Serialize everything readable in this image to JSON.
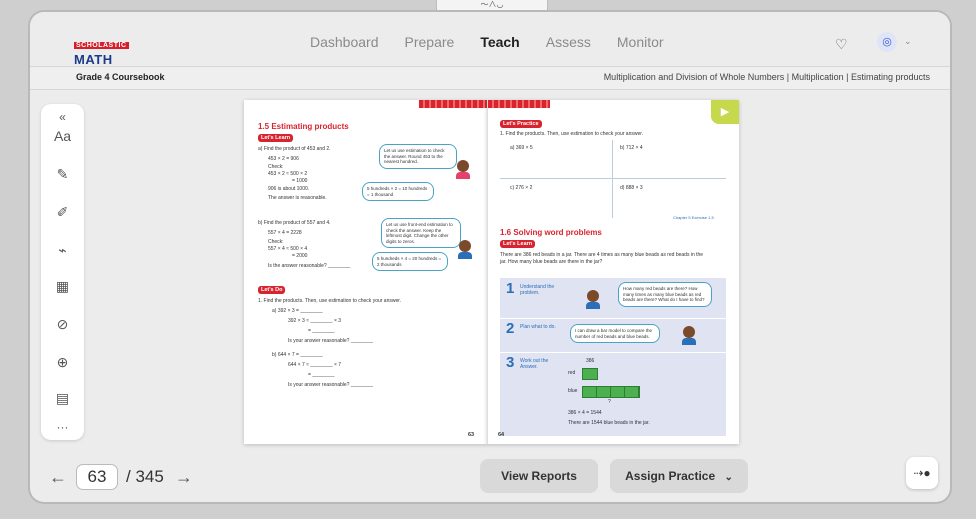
{
  "logo": {
    "top": "SCHOLASTIC",
    "main": "MATH PRO"
  },
  "nav": {
    "tabs": [
      "Dashboard",
      "Prepare",
      "Teach",
      "Assess",
      "Monitor"
    ],
    "active": "Teach"
  },
  "coursebook": "Grade 4 Coursebook",
  "breadcrumb": "Multiplication and Division of Whole Numbers | Multiplication | Estimating products",
  "toolbar": {
    "collapse": "«",
    "text_tool": "Aa",
    "more": "···"
  },
  "left_page": {
    "title": "1.5 Estimating products",
    "lets_learn": "Let's Learn",
    "a_q": "a)  Find the product of 453 and 2.",
    "a_eq": "453 × 2 = 906",
    "a_check": "Check:",
    "a_c1": "453 × 2 ≈ 500 × 2",
    "a_c2": "= 1000",
    "a_c3": "906 is about 1000.",
    "a_c4": "The answer is reasonable.",
    "a_bubble": "Let us use estimation to check the answer. Round 453 to the nearest hundred.",
    "a_note": "5 hundreds × 2 = 10 hundreds = 1 thousand",
    "b_q": "b)  Find the product of 557 and 4.",
    "b_eq": "557 × 4 = 2228",
    "b_check": "Check:",
    "b_c1": "557 × 4 ≈ 500 × 4",
    "b_c2": "= 2000",
    "b_c3": "Is the answer reasonable? ________",
    "b_bubble": "Let us use front-end estimation to check the answer. Keep the leftmost digit. Change the other digits to zeros.",
    "b_note": "5 hundreds × 4 = 20 hundreds = 2 thousands",
    "lets_do": "Let's Do",
    "d1": "1.  Find the products. Then, use estimation to check your answer.",
    "d_a1": "a)  392 × 3 = ________",
    "d_a2": "392 × 3 ≈ ________ × 3",
    "d_a3": "= ________",
    "d_a4": "Is your answer reasonable? ________",
    "d_b1": "b)  644 × 7 = ________",
    "d_b2": "644 × 7 ≈ ________ × 7",
    "d_b3": "= ________",
    "d_b4": "Is your answer reasonable? ________",
    "page_number": "63"
  },
  "right_page": {
    "lets_practice": "Let's Practice",
    "p1": "1.  Find the products. Then, use estimation to check your answer.",
    "pa": "a)  369 × 5",
    "pb": "b)  712 × 4",
    "pc": "c)  276 × 2",
    "pd": "d)  888 × 3",
    "exercise": "Chapter 5 Exercise 1.5",
    "title": "1.6 Solving word problems",
    "lets_learn": "Let's Learn",
    "problem": "There are 386 red beads in a jar. There are 4 times as many blue beads as red beads in the jar. How many blue beads are there in the jar?",
    "s1": "Understand the problem.",
    "s1_bubble": "How many red beads are there? How many times as many blue beads as red beads are there? What do I have to find?",
    "s2": "Plan what to do.",
    "s2_bubble": "I can draw a bar model to compare the number of red beads and blue beads.",
    "s3": "Work out the Answer.",
    "bar_top": "386",
    "red": "red",
    "blue": "blue",
    "bar_q": "?",
    "eq": "386 × 4 = 1544",
    "answer": "There are 1544 blue beads in the jar.",
    "page_number": "64"
  },
  "pager": {
    "current": "63",
    "total": "/ 345",
    "prev": "←",
    "next": "→"
  },
  "buttons": {
    "view_reports": "View Reports",
    "assign_practice": "Assign Practice",
    "assign_chevron": "⌄"
  },
  "colors": {
    "accent": "#d8242f",
    "brand": "#1b3a8a",
    "step": "#2a6fb8"
  }
}
